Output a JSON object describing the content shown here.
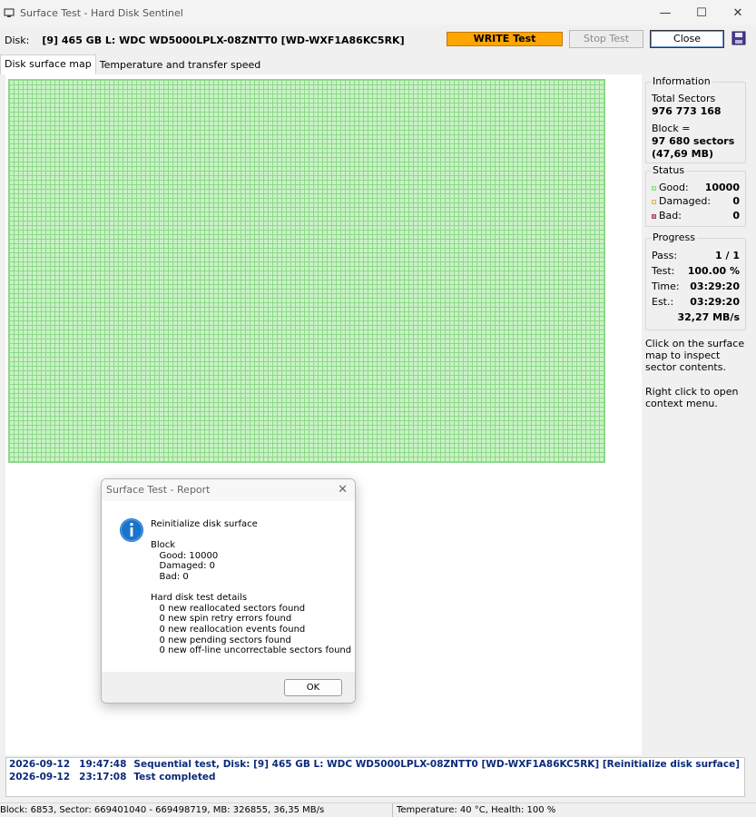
{
  "window": {
    "title": "Surface Test - Hard Disk Sentinel"
  },
  "toolbar": {
    "disk_label": "Disk:",
    "disk_value": "[9] 465 GB L: WDC WD5000LPLX-08ZNTT0 [WD-WXF1A86KC5RK]",
    "write_test_label": "WRITE Test",
    "stop_test_label": "Stop Test",
    "close_label": "Close"
  },
  "tabs": [
    {
      "label": "Disk surface map",
      "active": true
    },
    {
      "label": "Temperature and transfer speed",
      "active": false
    }
  ],
  "information": {
    "title": "Information",
    "total_sectors_label": "Total Sectors",
    "total_sectors_value": "976 773 168",
    "block_label": "Block =",
    "block_sectors": "97 680 sectors",
    "block_size": "(47,69 MB)"
  },
  "status": {
    "title": "Status",
    "good_label": "Good:",
    "good_value": "10000",
    "damaged_label": "Damaged:",
    "damaged_value": "0",
    "bad_label": "Bad:",
    "bad_value": "0"
  },
  "progress": {
    "title": "Progress",
    "pass_label": "Pass:",
    "pass_value": "1 / 1",
    "test_label": "Test:",
    "test_value": "100.00 %",
    "time_label": "Time:",
    "time_value": "03:29:20",
    "est_label": "Est.:",
    "est_value": "03:29:20",
    "speed_value": "32,27 MB/s"
  },
  "hints": {
    "click": "Click on the surface map to inspect sector contents.",
    "right_click": "Right click to open context menu."
  },
  "log": [
    {
      "date": "2026-09-12",
      "time": "19:47:48",
      "message": "Sequential test, Disk: [9] 465 GB L: WDC WD5000LPLX-08ZNTT0 [WD-WXF1A86KC5RK] [Reinitialize disk surface]"
    },
    {
      "date": "2026-09-12",
      "time": "23:17:08",
      "message": "Test completed"
    }
  ],
  "statusbar": {
    "left": "Block: 6853, Sector: 669401040 - 669498719, MB: 326855, 36,35 MB/s",
    "right": "Temperature: 40  °C,  Health: 100 %"
  },
  "dialog": {
    "title": "Surface Test - Report",
    "body": "Reinitialize disk surface\n\nBlock\n   Good: 10000\n   Damaged: 0\n   Bad: 0\n\nHard disk test details\n   0 new reallocated sectors found\n   0 new spin retry errors found\n   0 new reallocation events found\n   0 new pending sectors found\n   0 new off-line uncorrectable sectors found",
    "ok_label": "OK"
  },
  "colors": {
    "good_block": "#c9f2c6",
    "good_grid": "#8ed88a",
    "write_button": "#ffa500",
    "log_text": "#0a2a7a",
    "info_icon": "#1a73c8"
  }
}
